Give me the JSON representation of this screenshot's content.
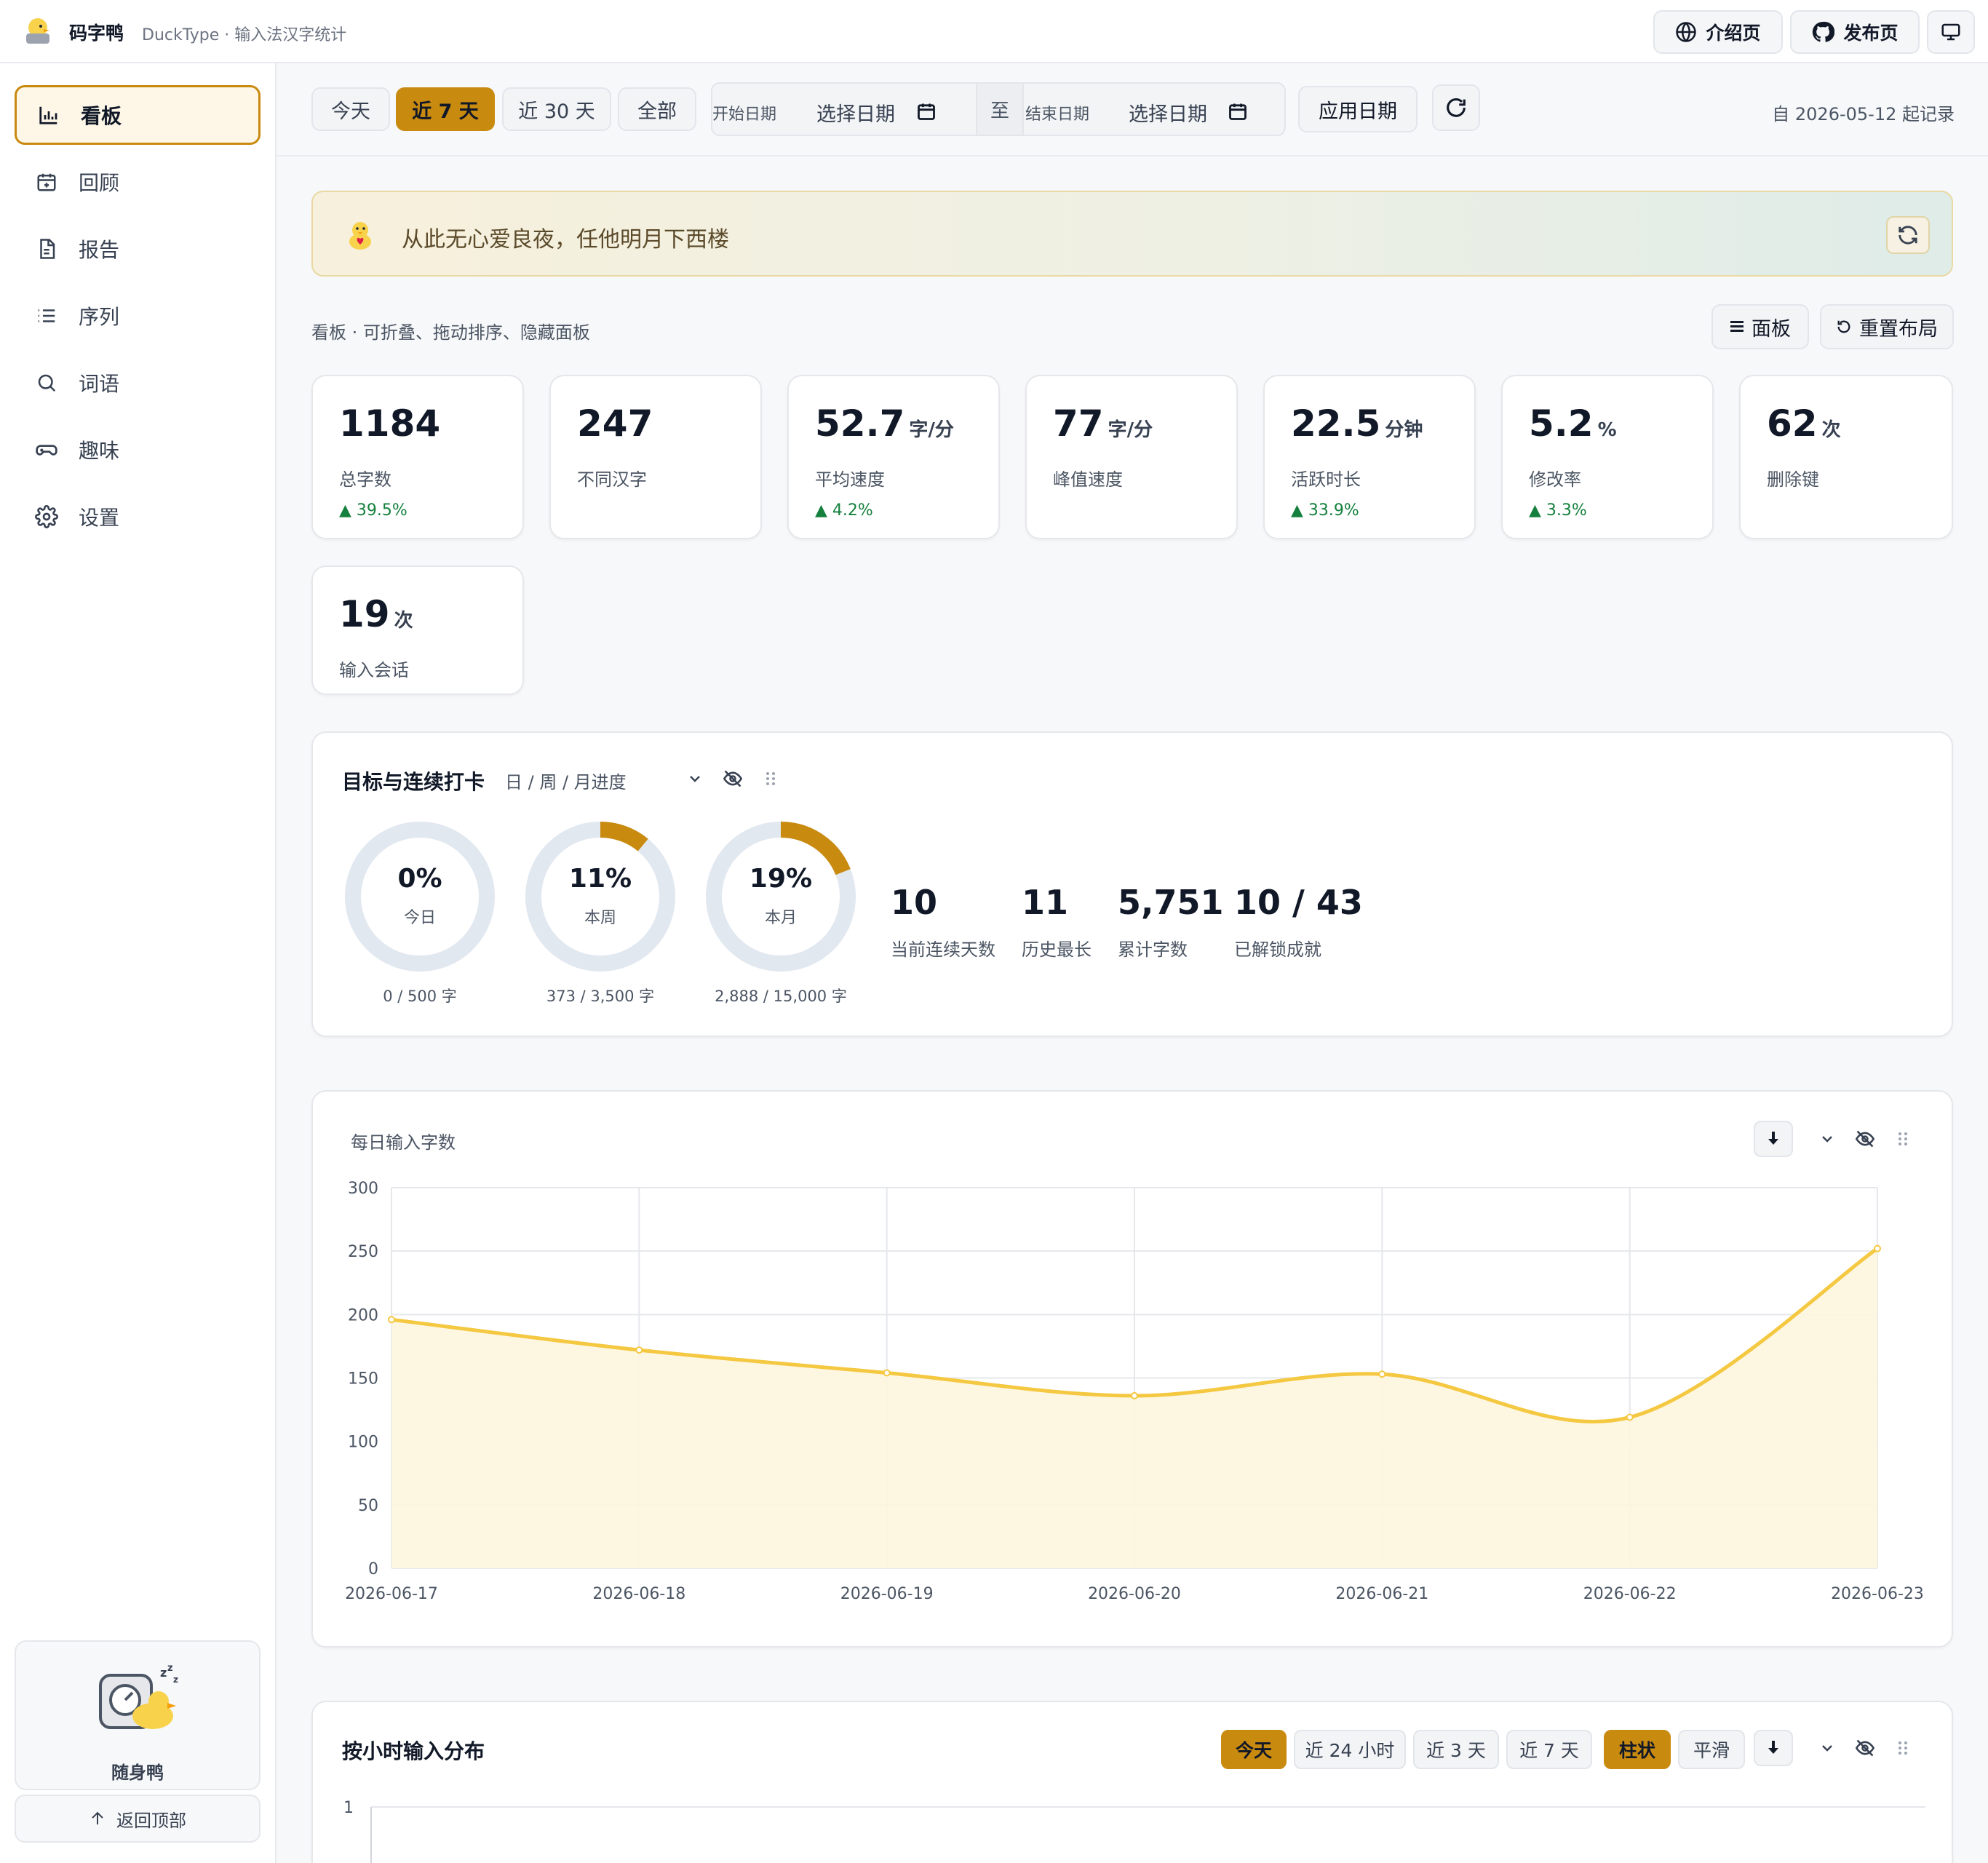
{
  "app": {
    "name": "码字鸭",
    "subtitle": "DuckType · 输入法汉字统计",
    "intro_label": "介绍页",
    "release_label": "发布页"
  },
  "sidebar": {
    "items": [
      {
        "label": "看板",
        "icon": "bar-chart-icon",
        "active": true
      },
      {
        "label": "回顾",
        "icon": "calendar-icon"
      },
      {
        "label": "报告",
        "icon": "document-icon"
      },
      {
        "label": "序列",
        "icon": "list-icon"
      },
      {
        "label": "词语",
        "icon": "search-icon"
      },
      {
        "label": "趣味",
        "icon": "gamepad-icon"
      },
      {
        "label": "设置",
        "icon": "gear-icon"
      }
    ],
    "mascot_label": "随身鸭",
    "back_to_top": "返回顶部"
  },
  "toolbar": {
    "ranges": [
      "今天",
      "近 7 天",
      "近 30 天",
      "全部"
    ],
    "active_range": "近 7 天",
    "start_label": "开始日期",
    "start_value": "选择日期",
    "to_label": "至",
    "end_label": "结束日期",
    "end_value": "选择日期",
    "apply_label": "应用日期",
    "since_text": "自 2026-05-12 起记录"
  },
  "quote": {
    "text": "从此无心爱良夜，任他明月下西楼"
  },
  "board": {
    "hint": "看板 · 可折叠、拖动排序、隐藏面板",
    "panels_label": "面板",
    "reset_label": "重置布局"
  },
  "stats": [
    {
      "value": "1184",
      "unit": "",
      "label": "总字数",
      "delta": "▲ 39.5%"
    },
    {
      "value": "247",
      "unit": "",
      "label": "不同汉字",
      "delta": ""
    },
    {
      "value": "52.7",
      "unit": "字/分",
      "label": "平均速度",
      "delta": "▲ 4.2%"
    },
    {
      "value": "77",
      "unit": "字/分",
      "label": "峰值速度",
      "delta": ""
    },
    {
      "value": "22.5",
      "unit": "分钟",
      "label": "活跃时长",
      "delta": "▲ 33.9%"
    },
    {
      "value": "5.2",
      "unit": "%",
      "label": "修改率",
      "delta": "▲ 3.3%"
    },
    {
      "value": "62",
      "unit": "次",
      "label": "删除键",
      "delta": ""
    },
    {
      "value": "19",
      "unit": "次",
      "label": "输入会话",
      "delta": ""
    }
  ],
  "goals": {
    "title": "目标与连续打卡",
    "subtitle": "日 / 周 / 月进度",
    "rings": [
      {
        "pct_text": "0%",
        "pct": 0,
        "label": "今日",
        "caption": "0 / 500 字"
      },
      {
        "pct_text": "11%",
        "pct": 0.11,
        "label": "本周",
        "caption": "373 / 3,500 字"
      },
      {
        "pct_text": "19%",
        "pct": 0.19,
        "label": "本月",
        "caption": "2,888 / 15,000 字"
      }
    ],
    "streaks": [
      {
        "value": "10",
        "label": "当前连续天数"
      },
      {
        "value": "11",
        "label": "历史最长"
      },
      {
        "value": "5,751",
        "label": "累计字数"
      },
      {
        "value": "10 / 43",
        "label": "已解锁成就"
      }
    ]
  },
  "daily": {
    "title": "每日输入字数"
  },
  "hourly": {
    "title": "按小时输入分布",
    "ranges": [
      "今天",
      "近 24 小时",
      "近 3 天",
      "近 7 天"
    ],
    "active_range": "今天",
    "modes": [
      "柱状",
      "平滑"
    ],
    "active_mode": "柱状",
    "y_top_tick": "1"
  },
  "colors": {
    "accent": "#c98a10",
    "line": "#f5c842",
    "area": "#fdf6df",
    "delta_up": "#15803d"
  },
  "chart_data": {
    "type": "area",
    "title": "每日输入字数",
    "x": [
      "2026-06-17",
      "2026-06-18",
      "2026-06-19",
      "2026-06-20",
      "2026-06-21",
      "2026-06-22",
      "2026-06-23"
    ],
    "values": [
      196,
      172,
      154,
      136,
      153,
      119,
      252
    ],
    "ylim": [
      0,
      300
    ],
    "yticks": [
      0,
      50,
      100,
      150,
      200,
      250,
      300
    ],
    "grid": true,
    "smooth": true
  }
}
